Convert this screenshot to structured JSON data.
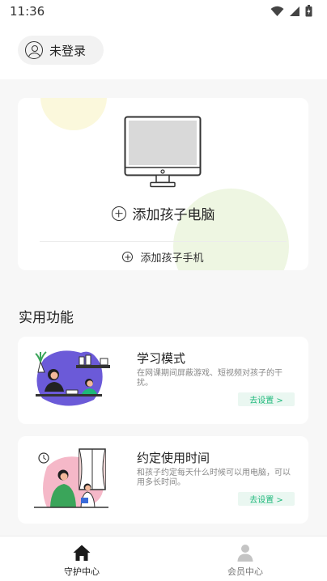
{
  "status_bar": {
    "time": "11:36",
    "icons": [
      "wifi-icon",
      "signal-icon",
      "battery-icon"
    ]
  },
  "header": {
    "login_label": "未登录"
  },
  "device_card": {
    "add_pc_label": "添加孩子电脑",
    "add_phone_label": "添加孩子手机"
  },
  "features": {
    "section_title": "实用功能",
    "items": [
      {
        "title": "学习模式",
        "description": "在网课期间屏蔽游戏、短视频对孩子的干扰。",
        "button": "去设置 >"
      },
      {
        "title": "约定使用时间",
        "description": "和孩子约定每天什么时候可以用电脑，可以用多长时间。",
        "button": "去设置 >"
      }
    ]
  },
  "bottom_nav": {
    "items": [
      {
        "label": "守护中心",
        "icon": "home-icon",
        "active": true
      },
      {
        "label": "会员中心",
        "icon": "person-icon",
        "active": false
      }
    ]
  },
  "colors": {
    "accent_green": "#1db87a",
    "button_bg": "#eaf7f1",
    "page_bg": "#f7f7f7",
    "inactive_nav": "#c4c4c4"
  }
}
